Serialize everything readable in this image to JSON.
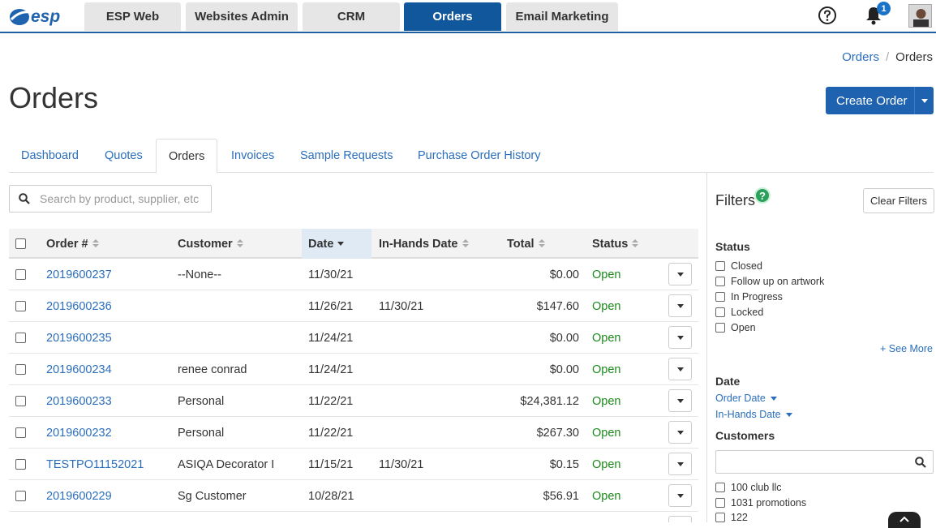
{
  "app_tabs": [
    {
      "label": "ESP Web",
      "active": false
    },
    {
      "label": "Websites Admin",
      "active": false
    },
    {
      "label": "CRM",
      "active": false
    },
    {
      "label": "Orders",
      "active": true
    },
    {
      "label": "Email Marketing",
      "active": false
    }
  ],
  "logo": {
    "text": "esp"
  },
  "notifications": {
    "count": "1"
  },
  "breadcrumb": {
    "parent": "Orders",
    "current": "Orders"
  },
  "page": {
    "title": "Orders",
    "create_button": "Create Order"
  },
  "subtabs": [
    {
      "label": "Dashboard",
      "active": false
    },
    {
      "label": "Quotes",
      "active": false
    },
    {
      "label": "Orders",
      "active": true
    },
    {
      "label": "Invoices",
      "active": false
    },
    {
      "label": "Sample Requests",
      "active": false
    },
    {
      "label": "Purchase Order History",
      "active": false
    }
  ],
  "search": {
    "placeholder": "Search by product, supplier, etc.",
    "value": ""
  },
  "table": {
    "columns": {
      "order": "Order #",
      "customer": "Customer",
      "date": "Date",
      "in_hands": "In-Hands Date",
      "total": "Total",
      "status": "Status"
    },
    "sorted_column": "Date",
    "rows": [
      {
        "order": "2019600237",
        "customer": "--None--",
        "date": "11/30/21",
        "in_hands": "",
        "total": "$0.00",
        "status": "Open"
      },
      {
        "order": "2019600236",
        "customer": "",
        "date": "11/26/21",
        "in_hands": "11/30/21",
        "total": "$147.60",
        "status": "Open"
      },
      {
        "order": "2019600235",
        "customer": "",
        "date": "11/24/21",
        "in_hands": "",
        "total": "$0.00",
        "status": "Open"
      },
      {
        "order": "2019600234",
        "customer": "renee conrad",
        "date": "11/24/21",
        "in_hands": "",
        "total": "$0.00",
        "status": "Open"
      },
      {
        "order": "2019600233",
        "customer": "Personal",
        "date": "11/22/21",
        "in_hands": "",
        "total": "$24,381.12",
        "status": "Open"
      },
      {
        "order": "2019600232",
        "customer": "Personal",
        "date": "11/22/21",
        "in_hands": "",
        "total": "$267.30",
        "status": "Open"
      },
      {
        "order": "TESTPO11152021",
        "customer": "ASIQA Decorator I",
        "date": "11/15/21",
        "in_hands": "11/30/21",
        "total": "$0.15",
        "status": "Open"
      },
      {
        "order": "2019600229",
        "customer": "Sg Customer",
        "date": "10/28/21",
        "in_hands": "",
        "total": "$56.91",
        "status": "Open"
      }
    ]
  },
  "filters": {
    "title": "Filters",
    "help": "?",
    "clear_button": "Clear Filters",
    "status": {
      "label": "Status",
      "options": [
        "Closed",
        "Follow up on artwork",
        "In Progress",
        "Locked",
        "Open"
      ],
      "see_more": "+ See More"
    },
    "date": {
      "label": "Date",
      "options": [
        "Order Date",
        "In-Hands Date"
      ]
    },
    "customers": {
      "label": "Customers",
      "search_value": "",
      "options": [
        "100 club llc",
        "1031 promotions",
        "122"
      ]
    }
  },
  "colors": {
    "brand": "#11579c",
    "link": "#2a6ebb",
    "open_status": "#1b8a1b"
  }
}
